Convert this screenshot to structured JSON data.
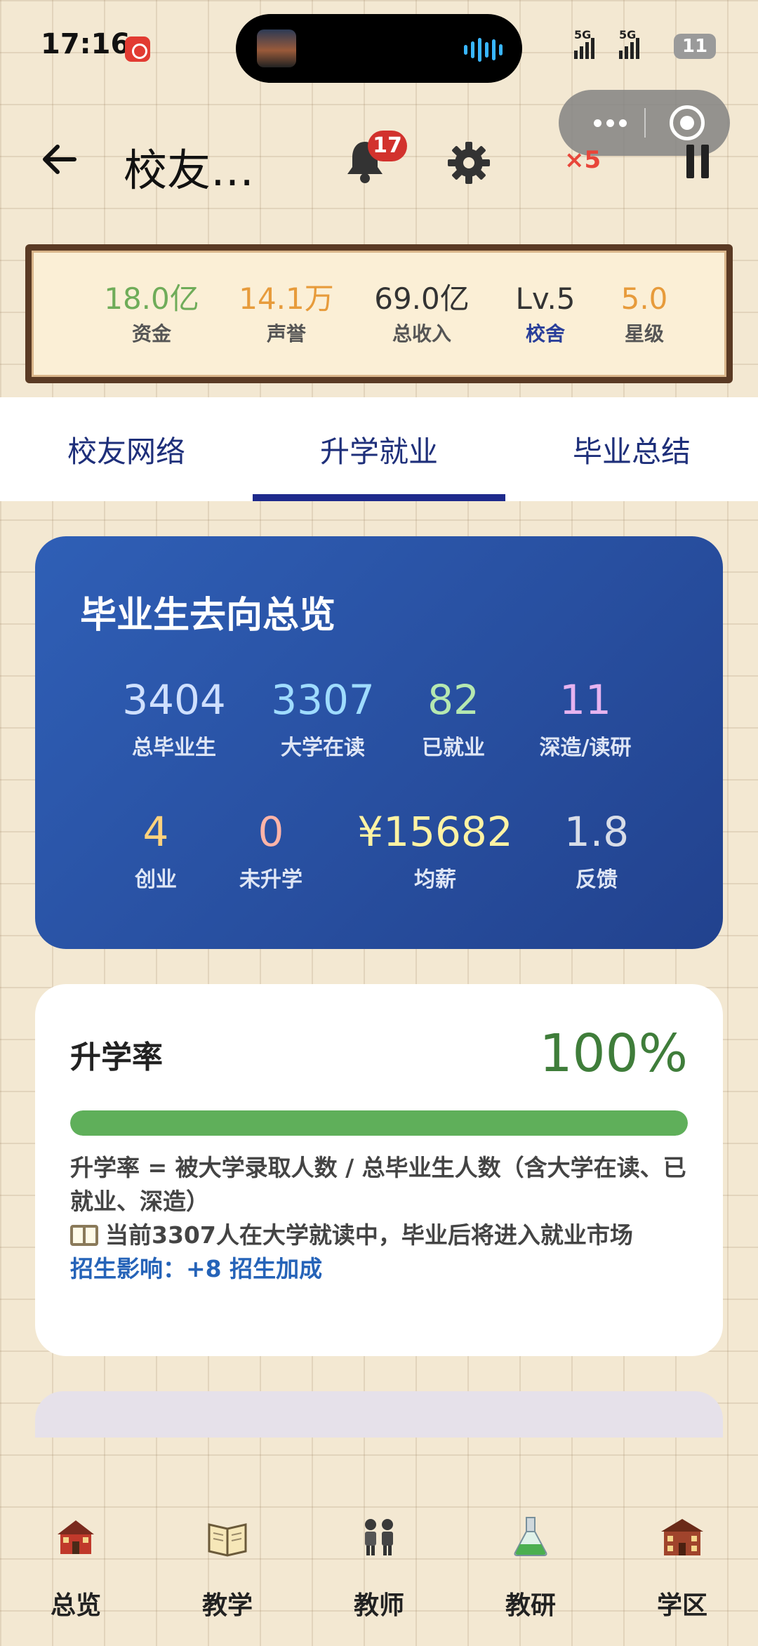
{
  "status_bar": {
    "time": "17:16",
    "signal_1": "5G",
    "signal_2": "5G",
    "battery": "11"
  },
  "header": {
    "title": "校友…",
    "notification_count": "17",
    "speed": "×5",
    "icons": [
      "back-arrow-icon",
      "bell-icon",
      "gear-icon",
      "pause-icon",
      "more-icon",
      "target-icon"
    ]
  },
  "stats": [
    {
      "value": "18.0亿",
      "label": "资金",
      "color": "#6fac59",
      "label_color": "#555555"
    },
    {
      "value": "14.1万",
      "label": "声誉",
      "color": "#e79b3b",
      "label_color": "#555555"
    },
    {
      "value": "69.0亿",
      "label": "总收入",
      "color": "#333333",
      "label_color": "#555555"
    },
    {
      "value": "Lv.5",
      "label": "校舍",
      "color": "#333333",
      "label_color": "#2a3f9a"
    },
    {
      "value": "5.0",
      "label": "星级",
      "color": "#e79b3b",
      "label_color": "#555555"
    }
  ],
  "tabs": [
    {
      "label": "校友网络",
      "active": false
    },
    {
      "label": "升学就业",
      "active": true
    },
    {
      "label": "毕业总结",
      "active": false
    }
  ],
  "overview": {
    "title": "毕业生去向总览",
    "items": [
      {
        "value": "3404",
        "label": "总毕业生",
        "color": "#cfe0ff"
      },
      {
        "value": "3307",
        "label": "大学在读",
        "color": "#9fdcff"
      },
      {
        "value": "82",
        "label": "已就业",
        "color": "#b5e8b0"
      },
      {
        "value": "11",
        "label": "深造/读研",
        "color": "#e6b3f0"
      },
      {
        "value": "4",
        "label": "创业",
        "color": "#ffd27d"
      },
      {
        "value": "0",
        "label": "未升学",
        "color": "#ffb4a8"
      },
      {
        "value": "¥15682",
        "label": "均薪",
        "color": "#fff3a3"
      },
      {
        "value": "1.8",
        "label": "反馈",
        "color": "#d8dde8"
      }
    ]
  },
  "rate_card": {
    "title": "升学率",
    "value": "100%",
    "progress": 1.0,
    "formula": "升学率 = 被大学录取人数 / 总毕业生人数（含大学在读、已就业、深造）",
    "note": "当前3307人在大学就读中，毕业后将进入就业市场",
    "note_icon": "book-icon",
    "effect": "招生影响：+8 招生加成",
    "value_color": "#3f7d3a",
    "bar_color": "#5faf5a"
  },
  "bottom_nav": [
    {
      "label": "总览",
      "icon": "school-house-icon"
    },
    {
      "label": "教学",
      "icon": "open-book-icon"
    },
    {
      "label": "教师",
      "icon": "teachers-icon"
    },
    {
      "label": "教研",
      "icon": "flask-icon"
    },
    {
      "label": "学区",
      "icon": "school-building-icon"
    }
  ]
}
